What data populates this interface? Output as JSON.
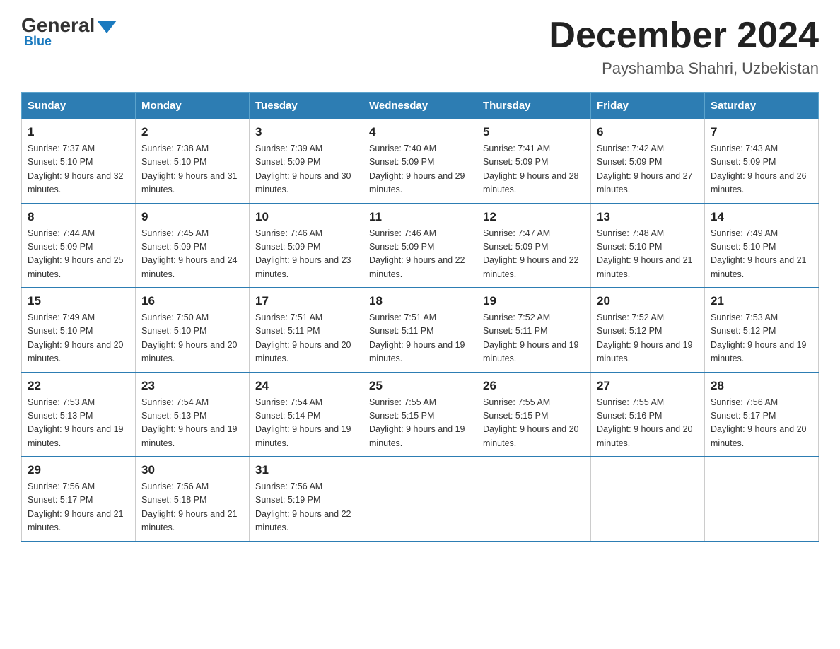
{
  "header": {
    "logo_general": "General",
    "logo_blue": "Blue",
    "month_title": "December 2024",
    "location": "Payshamba Shahri, Uzbekistan"
  },
  "days_of_week": [
    "Sunday",
    "Monday",
    "Tuesday",
    "Wednesday",
    "Thursday",
    "Friday",
    "Saturday"
  ],
  "weeks": [
    [
      {
        "day": "1",
        "sunrise": "7:37 AM",
        "sunset": "5:10 PM",
        "daylight": "9 hours and 32 minutes."
      },
      {
        "day": "2",
        "sunrise": "7:38 AM",
        "sunset": "5:10 PM",
        "daylight": "9 hours and 31 minutes."
      },
      {
        "day": "3",
        "sunrise": "7:39 AM",
        "sunset": "5:09 PM",
        "daylight": "9 hours and 30 minutes."
      },
      {
        "day": "4",
        "sunrise": "7:40 AM",
        "sunset": "5:09 PM",
        "daylight": "9 hours and 29 minutes."
      },
      {
        "day": "5",
        "sunrise": "7:41 AM",
        "sunset": "5:09 PM",
        "daylight": "9 hours and 28 minutes."
      },
      {
        "day": "6",
        "sunrise": "7:42 AM",
        "sunset": "5:09 PM",
        "daylight": "9 hours and 27 minutes."
      },
      {
        "day": "7",
        "sunrise": "7:43 AM",
        "sunset": "5:09 PM",
        "daylight": "9 hours and 26 minutes."
      }
    ],
    [
      {
        "day": "8",
        "sunrise": "7:44 AM",
        "sunset": "5:09 PM",
        "daylight": "9 hours and 25 minutes."
      },
      {
        "day": "9",
        "sunrise": "7:45 AM",
        "sunset": "5:09 PM",
        "daylight": "9 hours and 24 minutes."
      },
      {
        "day": "10",
        "sunrise": "7:46 AM",
        "sunset": "5:09 PM",
        "daylight": "9 hours and 23 minutes."
      },
      {
        "day": "11",
        "sunrise": "7:46 AM",
        "sunset": "5:09 PM",
        "daylight": "9 hours and 22 minutes."
      },
      {
        "day": "12",
        "sunrise": "7:47 AM",
        "sunset": "5:09 PM",
        "daylight": "9 hours and 22 minutes."
      },
      {
        "day": "13",
        "sunrise": "7:48 AM",
        "sunset": "5:10 PM",
        "daylight": "9 hours and 21 minutes."
      },
      {
        "day": "14",
        "sunrise": "7:49 AM",
        "sunset": "5:10 PM",
        "daylight": "9 hours and 21 minutes."
      }
    ],
    [
      {
        "day": "15",
        "sunrise": "7:49 AM",
        "sunset": "5:10 PM",
        "daylight": "9 hours and 20 minutes."
      },
      {
        "day": "16",
        "sunrise": "7:50 AM",
        "sunset": "5:10 PM",
        "daylight": "9 hours and 20 minutes."
      },
      {
        "day": "17",
        "sunrise": "7:51 AM",
        "sunset": "5:11 PM",
        "daylight": "9 hours and 20 minutes."
      },
      {
        "day": "18",
        "sunrise": "7:51 AM",
        "sunset": "5:11 PM",
        "daylight": "9 hours and 19 minutes."
      },
      {
        "day": "19",
        "sunrise": "7:52 AM",
        "sunset": "5:11 PM",
        "daylight": "9 hours and 19 minutes."
      },
      {
        "day": "20",
        "sunrise": "7:52 AM",
        "sunset": "5:12 PM",
        "daylight": "9 hours and 19 minutes."
      },
      {
        "day": "21",
        "sunrise": "7:53 AM",
        "sunset": "5:12 PM",
        "daylight": "9 hours and 19 minutes."
      }
    ],
    [
      {
        "day": "22",
        "sunrise": "7:53 AM",
        "sunset": "5:13 PM",
        "daylight": "9 hours and 19 minutes."
      },
      {
        "day": "23",
        "sunrise": "7:54 AM",
        "sunset": "5:13 PM",
        "daylight": "9 hours and 19 minutes."
      },
      {
        "day": "24",
        "sunrise": "7:54 AM",
        "sunset": "5:14 PM",
        "daylight": "9 hours and 19 minutes."
      },
      {
        "day": "25",
        "sunrise": "7:55 AM",
        "sunset": "5:15 PM",
        "daylight": "9 hours and 19 minutes."
      },
      {
        "day": "26",
        "sunrise": "7:55 AM",
        "sunset": "5:15 PM",
        "daylight": "9 hours and 20 minutes."
      },
      {
        "day": "27",
        "sunrise": "7:55 AM",
        "sunset": "5:16 PM",
        "daylight": "9 hours and 20 minutes."
      },
      {
        "day": "28",
        "sunrise": "7:56 AM",
        "sunset": "5:17 PM",
        "daylight": "9 hours and 20 minutes."
      }
    ],
    [
      {
        "day": "29",
        "sunrise": "7:56 AM",
        "sunset": "5:17 PM",
        "daylight": "9 hours and 21 minutes."
      },
      {
        "day": "30",
        "sunrise": "7:56 AM",
        "sunset": "5:18 PM",
        "daylight": "9 hours and 21 minutes."
      },
      {
        "day": "31",
        "sunrise": "7:56 AM",
        "sunset": "5:19 PM",
        "daylight": "9 hours and 22 minutes."
      },
      null,
      null,
      null,
      null
    ]
  ]
}
